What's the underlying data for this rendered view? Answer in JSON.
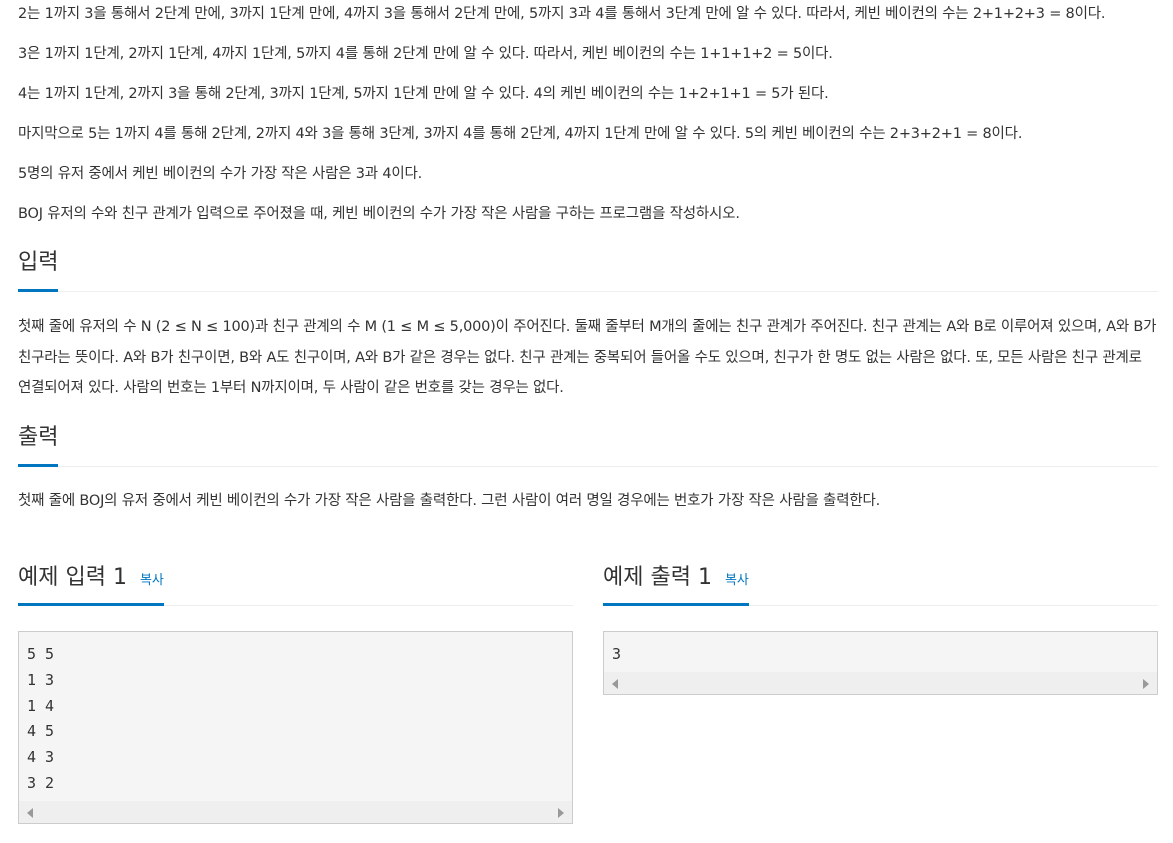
{
  "description_paragraphs": [
    "2는 1까지 3을 통해서 2단계 만에, 3까지 1단계 만에, 4까지 3을 통해서 2단계 만에, 5까지 3과 4를 통해서 3단계 만에 알 수 있다. 따라서, 케빈 베이컨의 수는 2+1+2+3 = 8이다.",
    "3은 1까지 1단계, 2까지 1단계, 4까지 1단계, 5까지 4를 통해 2단계 만에 알 수 있다. 따라서, 케빈 베이컨의 수는 1+1+1+2 = 5이다.",
    "4는 1까지 1단계, 2까지 3을 통해 2단계, 3까지 1단계, 5까지 1단계 만에 알 수 있다. 4의 케빈 베이컨의 수는 1+2+1+1 = 5가 된다.",
    "마지막으로 5는 1까지 4를 통해 2단계, 2까지 4와 3을 통해 3단계, 3까지 4를 통해 2단계, 4까지 1단계 만에 알 수 있다. 5의 케빈 베이컨의 수는 2+3+2+1 = 8이다.",
    "5명의 유저 중에서 케빈 베이컨의 수가 가장 작은 사람은 3과 4이다.",
    "BOJ 유저의 수와 친구 관계가 입력으로 주어졌을 때, 케빈 베이컨의 수가 가장 작은 사람을 구하는 프로그램을 작성하시오."
  ],
  "input_section": {
    "title": "입력",
    "text": "첫째 줄에 유저의 수 N (2 ≤ N ≤ 100)과 친구 관계의 수 M (1 ≤ M ≤ 5,000)이 주어진다. 둘째 줄부터 M개의 줄에는 친구 관계가 주어진다. 친구 관계는 A와 B로 이루어져 있으며, A와 B가 친구라는 뜻이다. A와 B가 친구이면, B와 A도 친구이며, A와 B가 같은 경우는 없다. 친구 관계는 중복되어 들어올 수도 있으며, 친구가 한 명도 없는 사람은 없다. 또, 모든 사람은 친구 관계로 연결되어져 있다. 사람의 번호는 1부터 N까지이며, 두 사람이 같은 번호를 갖는 경우는 없다."
  },
  "output_section": {
    "title": "출력",
    "text": "첫째 줄에 BOJ의 유저 중에서 케빈 베이컨의 수가 가장 작은 사람을 출력한다. 그런 사람이 여러 명일 경우에는 번호가 가장 작은 사람을 출력한다."
  },
  "sample_input": {
    "title": "예제 입력",
    "number": "1",
    "copy_label": "복사",
    "data": "5 5\n1 3\n1 4\n4 5\n4 3\n3 2"
  },
  "sample_output": {
    "title": "예제 출력",
    "number": "1",
    "copy_label": "복사",
    "data": "3"
  },
  "colors": {
    "accent": "#0076c0",
    "text": "#333333",
    "pre_bg": "#f5f5f5",
    "pre_border": "#cccccc"
  }
}
